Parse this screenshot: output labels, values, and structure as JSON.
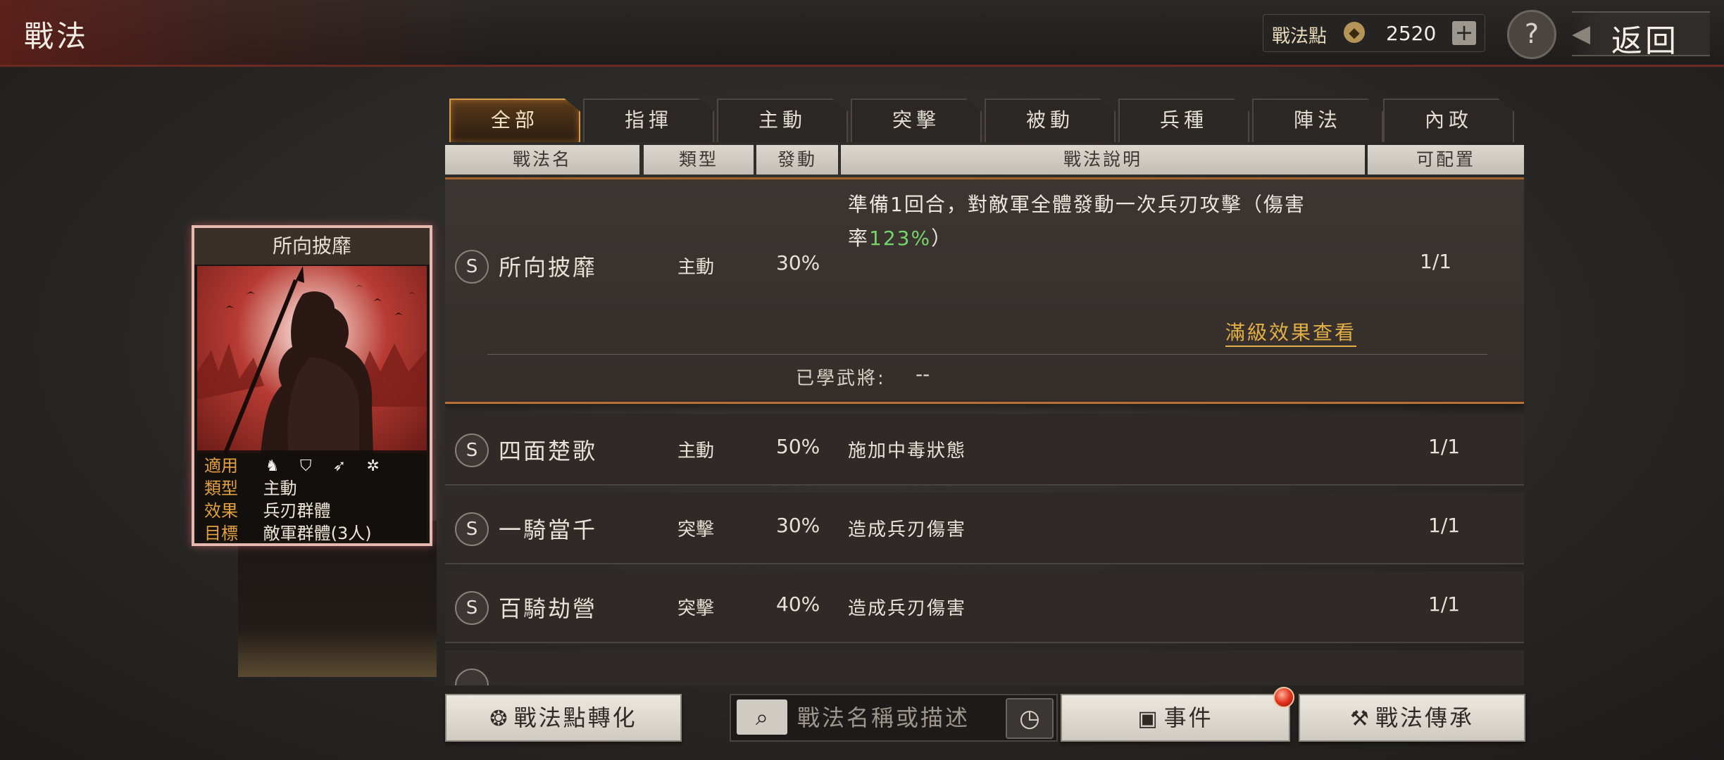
{
  "header": {
    "title": "戰法",
    "points_label": "戰法點",
    "points_value": "2520",
    "plus_label": "+",
    "help_label": "?",
    "back_label": "返回"
  },
  "card": {
    "title": "所向披靡",
    "info": [
      {
        "key": "適用",
        "value": ""
      },
      {
        "key": "類型",
        "value": "主動"
      },
      {
        "key": "效果",
        "value": "兵刃群體"
      },
      {
        "key": "目標",
        "value": "敵軍群體(3人)"
      }
    ],
    "unit_icons": [
      "cavalry-icon",
      "shield-icon",
      "spear-icon",
      "wheel-icon"
    ]
  },
  "tabs": [
    "全部",
    "指揮",
    "主動",
    "突擊",
    "被動",
    "兵種",
    "陣法",
    "內政"
  ],
  "active_tab": "全部",
  "columns": [
    "戰法名",
    "類型",
    "發動",
    "戰法說明",
    "可配置"
  ],
  "selected": {
    "badge": "S",
    "name": "所向披靡",
    "type": "主動",
    "rate": "30%",
    "desc_line1": "準備1回合，對敵軍全體發動一次兵刃攻擊（傷害",
    "desc_line2_prefix": "率",
    "desc_highlight": "123%",
    "desc_line2_suffix": "）",
    "config": "1/1",
    "max_link": "滿級效果查看",
    "learned_label": "已學武將:",
    "learned_value": "--"
  },
  "rows": [
    {
      "badge": "S",
      "name": "四面楚歌",
      "type": "主動",
      "rate": "50%",
      "desc": "施加中毒狀態",
      "config": "1/1"
    },
    {
      "badge": "S",
      "name": "一騎當千",
      "type": "突擊",
      "rate": "30%",
      "desc": "造成兵刃傷害",
      "config": "1/1"
    },
    {
      "badge": "S",
      "name": "百騎劫營",
      "type": "突擊",
      "rate": "40%",
      "desc": "造成兵刃傷害",
      "config": "1/1"
    }
  ],
  "bottom": {
    "convert_label": "戰法點轉化",
    "search_placeholder": "戰法名稱或描述",
    "event_label": "事件",
    "inherit_label": "戰法傳承"
  }
}
